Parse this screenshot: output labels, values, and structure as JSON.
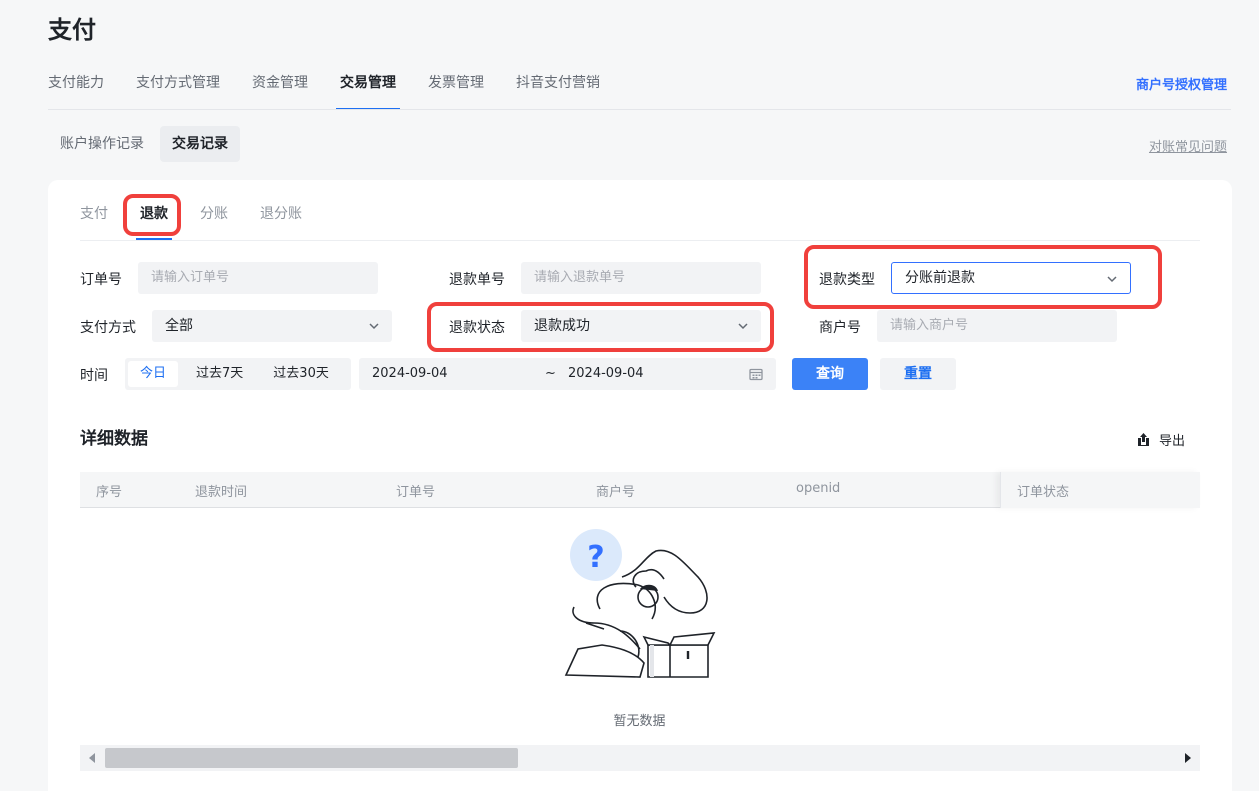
{
  "page": {
    "title": "支付"
  },
  "main_tabs": [
    {
      "label": "支付能力"
    },
    {
      "label": "支付方式管理"
    },
    {
      "label": "资金管理"
    },
    {
      "label": "交易管理",
      "active": true
    },
    {
      "label": "发票管理"
    },
    {
      "label": "抖音支付营销"
    }
  ],
  "header": {
    "auth_link": "商户号授权管理",
    "faq_link": "对账常见问题"
  },
  "sub_tabs": [
    {
      "label": "账户操作记录"
    },
    {
      "label": "交易记录",
      "active": true
    }
  ],
  "record_tabs": [
    {
      "label": "支付"
    },
    {
      "label": "退款",
      "active": true
    },
    {
      "label": "分账"
    },
    {
      "label": "退分账"
    }
  ],
  "filters": {
    "order_no": {
      "label": "订单号",
      "placeholder": "请输入订单号"
    },
    "refund_no": {
      "label": "退款单号",
      "placeholder": "请输入退款单号"
    },
    "refund_type": {
      "label": "退款类型",
      "value": "分账前退款"
    },
    "pay_method": {
      "label": "支付方式",
      "value": "全部"
    },
    "refund_status": {
      "label": "退款状态",
      "value": "退款成功"
    },
    "merchant_no": {
      "label": "商户号",
      "placeholder": "请输入商户号"
    },
    "time": {
      "label": "时间",
      "options": [
        "今日",
        "过去7天",
        "过去30天"
      ],
      "selected": "今日",
      "start": "2024-09-04",
      "separator": "~",
      "end": "2024-09-04"
    },
    "query_button": "查询",
    "reset_button": "重置"
  },
  "detail": {
    "title": "详细数据",
    "export_label": "导出",
    "columns": [
      "序号",
      "退款时间",
      "订单号",
      "商户号",
      "openid",
      "订单状态"
    ],
    "empty_text": "暂无数据",
    "horizontal_scroll_fraction": 0.37
  },
  "colors": {
    "accent": "#1d6ff2",
    "primary_button": "#3b82f7",
    "highlight": "#f0403c"
  }
}
